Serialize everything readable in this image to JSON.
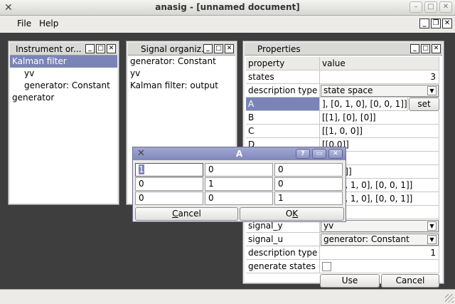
{
  "window": {
    "title": "anasig - [unnamed document]"
  },
  "menu": {
    "file": "File",
    "help": "Help"
  },
  "instrument_panel": {
    "title": "Instrument or...",
    "items": [
      "Kalman filter",
      "yv",
      "generator: Constant",
      "generator"
    ]
  },
  "signal_panel": {
    "title": "Signal organiz...",
    "items": [
      "generator: Constant",
      "yv",
      "Kalman filter: output"
    ]
  },
  "properties": {
    "title": "Properties",
    "header": {
      "property": "property",
      "value": "value"
    },
    "rows": [
      {
        "key": "states",
        "value": "3"
      },
      {
        "key": "description type",
        "value": "state space"
      },
      {
        "key": "A",
        "value": "], [0, 1, 0], [0, 0, 1]]",
        "button": "set"
      },
      {
        "key": "B",
        "value": "[[1], [0], [0]]"
      },
      {
        "key": "C",
        "value": "[[1, 0, 0]]"
      },
      {
        "key": "D",
        "value": "[[0.0]]"
      },
      {
        "key": "",
        "value": ""
      },
      {
        "key": "",
        "value": "0], [0]]"
      },
      {
        "key": "",
        "value": "0], [0, 1, 0], [0, 0, 1]]"
      },
      {
        "key": "",
        "value": "0], [0, 1, 0], [0, 0, 1]]"
      },
      {
        "key": "",
        "value": "]]"
      },
      {
        "key": "signal_y",
        "value": "yv"
      },
      {
        "key": "signal_u",
        "value": "generator: Constant"
      },
      {
        "key": "description type",
        "value": "1"
      },
      {
        "key": "generate states",
        "value": ""
      }
    ],
    "use_button": "Use",
    "cancel_button": "Cancel"
  },
  "dialog": {
    "title": "A",
    "help_button": "?",
    "matrix": [
      [
        "1",
        "0",
        "0"
      ],
      [
        "0",
        "1",
        "0"
      ],
      [
        "0",
        "0",
        "1"
      ]
    ],
    "cancel_label": "Cancel",
    "cancel_mnemonic": "C",
    "cancel_rest": "ancel",
    "ok_label": "OK",
    "ok_first": "O",
    "ok_mnemonic": "K"
  }
}
